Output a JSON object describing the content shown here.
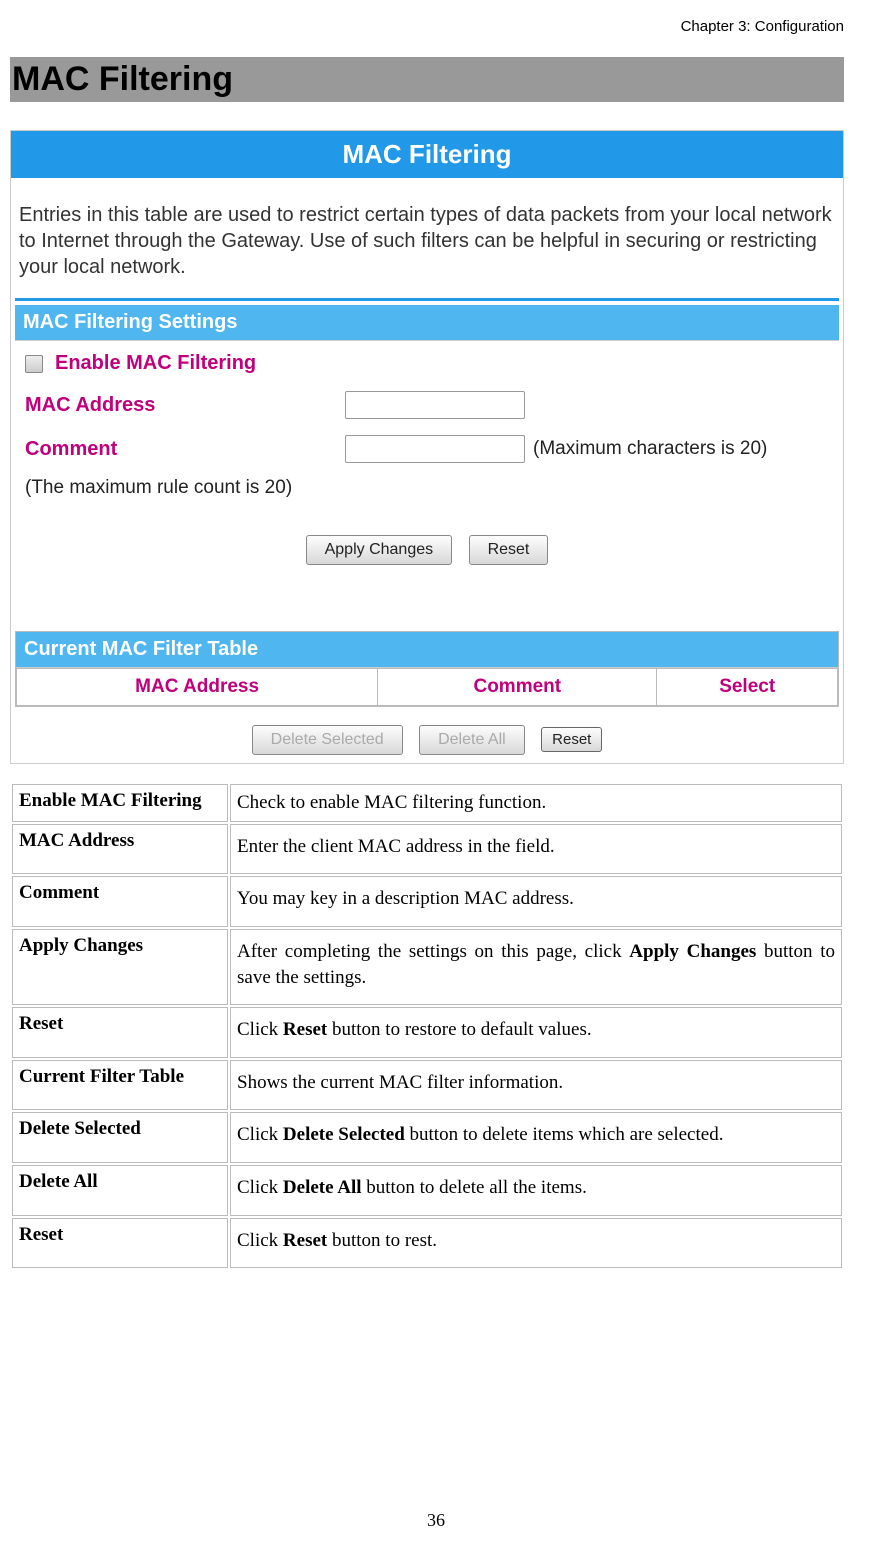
{
  "chapter": "Chapter 3: Configuration",
  "section_title": "MAC Filtering",
  "ui": {
    "banner": "MAC Filtering",
    "intro": "Entries in this table are used to restrict certain types of data packets from your local network to Internet through the Gateway. Use of such filters can be helpful in securing or restricting your local network.",
    "settings_header": "MAC Filtering Settings",
    "enable_label": "Enable MAC Filtering",
    "mac_label": "MAC Address",
    "comment_label": "Comment",
    "comment_after": "(Maximum characters is 20)",
    "rule_note": "(The maximum rule count is 20)",
    "apply_btn": "Apply Changes",
    "reset_btn": "Reset",
    "table_header": "Current MAC Filter Table",
    "col_mac": "MAC Address",
    "col_comment": "Comment",
    "col_select": "Select",
    "delete_selected_btn": "Delete Selected",
    "delete_all_btn": "Delete All",
    "reset2_btn": "Reset"
  },
  "descriptions": [
    {
      "key": "Enable MAC Filtering",
      "val_pre": "Check to enable MAC filtering function.",
      "val_bold": "",
      "val_post": ""
    },
    {
      "key": "MAC Address",
      "val_pre": "Enter the client MAC address in the field.",
      "val_bold": "",
      "val_post": ""
    },
    {
      "key": "Comment",
      "val_pre": "You may key in a description MAC address.",
      "val_bold": "",
      "val_post": ""
    },
    {
      "key": "Apply Changes",
      "val_pre": "After completing the settings on this page, click ",
      "val_bold": "Apply Changes",
      "val_post": " button to save the settings."
    },
    {
      "key": "Reset",
      "val_pre": "Click ",
      "val_bold": "Reset",
      "val_post": " button to restore to default values."
    },
    {
      "key": "Current Filter Table",
      "val_pre": "Shows the current MAC filter information.",
      "val_bold": "",
      "val_post": ""
    },
    {
      "key": "Delete Selected",
      "val_pre": "Click ",
      "val_bold": "Delete Selected",
      "val_post": " button to delete items which are selected."
    },
    {
      "key": "Delete All",
      "val_pre": "Click ",
      "val_bold": "Delete All",
      "val_post": " button to delete all the items."
    },
    {
      "key": "Reset",
      "val_pre": "Click ",
      "val_bold": "Reset",
      "val_post": " button to rest."
    }
  ],
  "page_number": "36"
}
